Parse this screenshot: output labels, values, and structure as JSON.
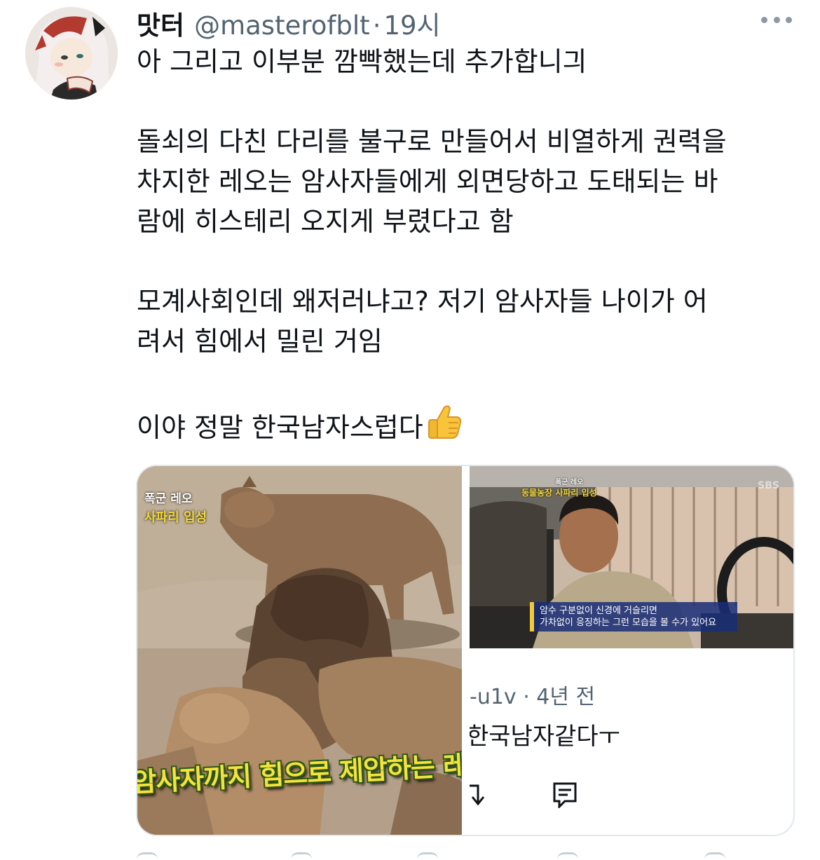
{
  "tweet": {
    "author_name": "맛터",
    "handle": "@masterofblt",
    "separator": "·",
    "time": "19시",
    "lines": [
      "아 그리고 이부분 깜빡했는데 추가합니긔",
      "",
      "돌쇠의 다친 다리를 불구로 만들어서 비열하게 권력을",
      "차지한 레오는 암사자들에게 외면당하고 도태되는 바",
      "람에 히스테리 오지게 부렸다고 함",
      "",
      "모계사회인데 왜저러냐고? 저기 암사자들 나이가 어",
      "려서 힘에서 밀린 거임",
      "",
      "이야 정말 한국남자스럽다"
    ],
    "emoji": "thumbs-up-emoji"
  },
  "media": {
    "left_tag_line1": "폭군 레오",
    "left_tag_line2": "사파리 입성",
    "left_caption": "암사자까지 힘으로 제압하는 레오",
    "right_tag_line1": "폭군 레오",
    "right_tag_line2": "동물농장 사파리 입성",
    "right_watermark": "SBS",
    "right_subtitle_line1": "암수 구분없이 신경에 거슬리면",
    "right_subtitle_line2": "가차없이 응징하는 그런 모습을 볼 수가 있어요"
  },
  "quoted": {
    "meta": "-u1v · 4년 전",
    "text": "한국남자같다ㅜ"
  },
  "icons": {
    "more": "more-icon",
    "reply": "reply-icon",
    "comment": "comment-icon"
  },
  "colors": {
    "text": "#0f1419",
    "muted": "#536471",
    "border": "#e1e8ed"
  }
}
